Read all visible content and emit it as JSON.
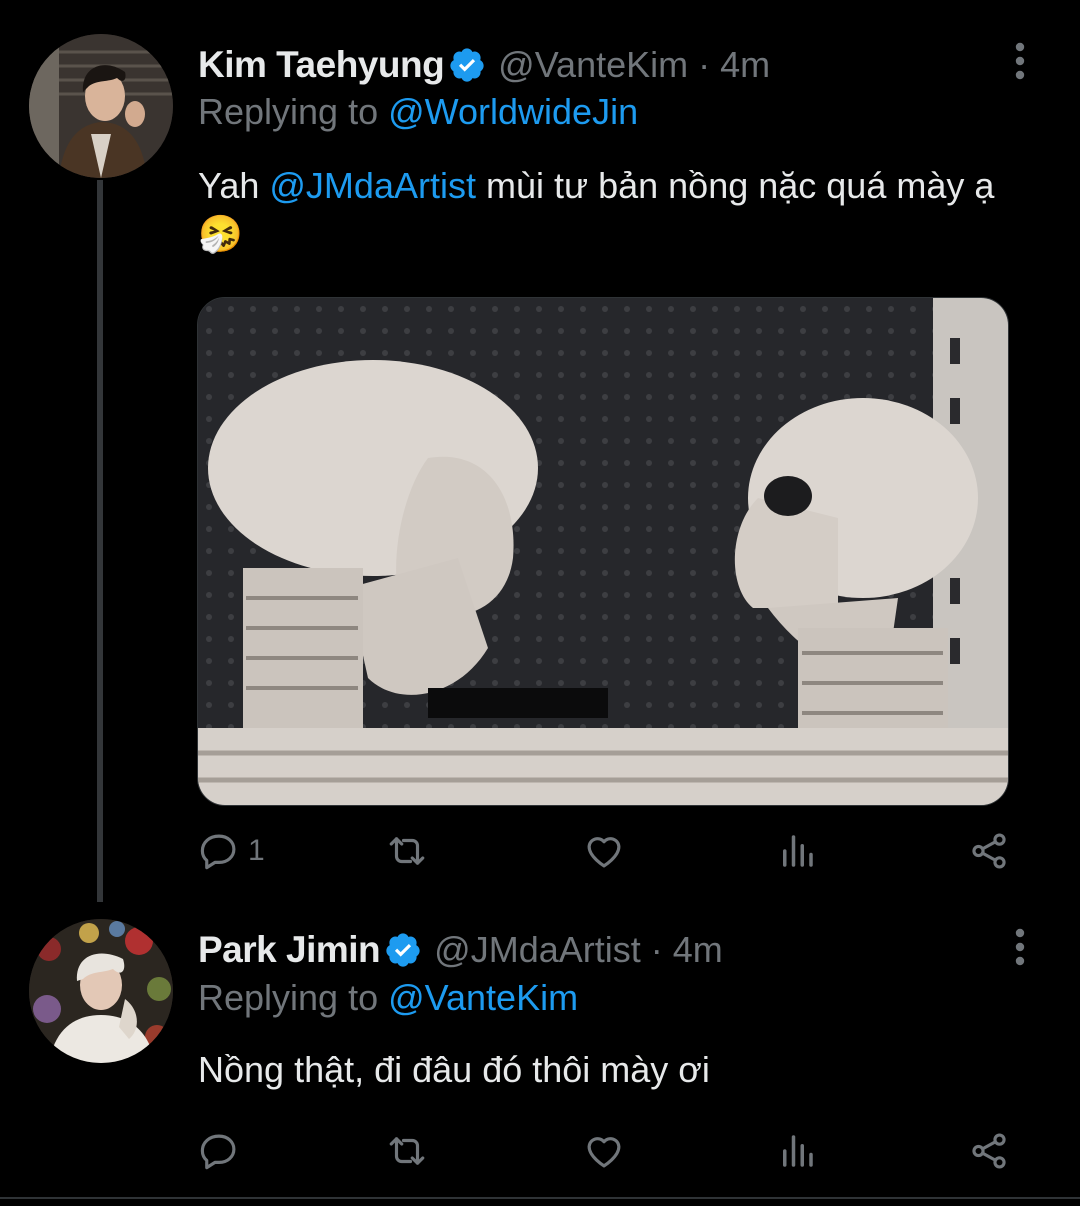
{
  "thread": {
    "tweet1": {
      "display_name": "Kim Taehyung",
      "handle": "@VanteKim",
      "separator": "·",
      "time": "4m",
      "replying_label": "Replying to",
      "replying_to": "@WorldwideJin",
      "text_prefix": "Yah ",
      "mention": "@JMdaArtist",
      "text_suffix": " mùi tư bản nồng nặc quá mày ạ",
      "emoji": "🤧",
      "reply_count": "1",
      "media_icon": "skeletons-image"
    },
    "tweet2": {
      "display_name": "Park Jimin",
      "handle": "@JMdaArtist",
      "separator": "·",
      "time": "4m",
      "replying_label": "Replying to",
      "replying_to": "@VanteKim",
      "text": "Nồng thật, đi đâu đó thôi mày ơi",
      "reply_count": ""
    }
  },
  "icons": [
    "more-icon",
    "verified-icon",
    "reply-icon",
    "retweet-icon",
    "like-icon",
    "analytics-icon",
    "share-icon"
  ],
  "colors": {
    "background": "#000000",
    "link": "#1d9bf0",
    "secondary": "#71767b",
    "verified": "#1d9bf0"
  }
}
